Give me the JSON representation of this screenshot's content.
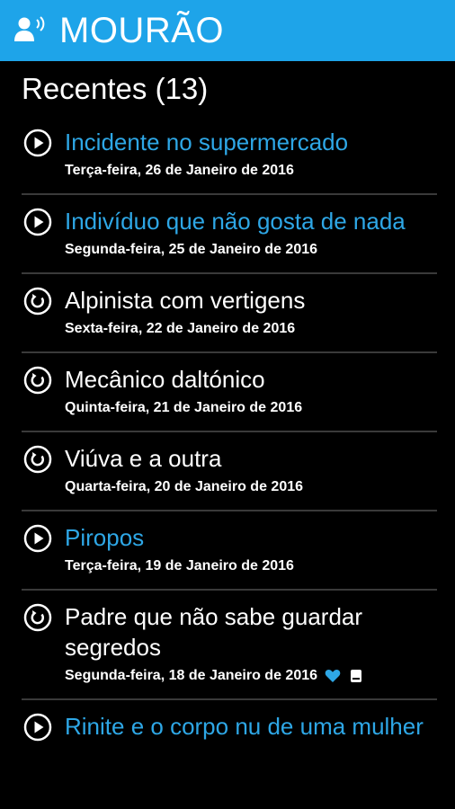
{
  "app": {
    "title": "MOURÃO",
    "brand_color": "#1ea4e9",
    "icon": "speaking-person-icon"
  },
  "section": {
    "title": "Recentes (13)"
  },
  "colors": {
    "new_title": "#2ea7e6",
    "played_title": "#ffffff",
    "divider": "#3a3a3a",
    "background": "#000000"
  },
  "episodes": [
    {
      "title": "Incidente no supermercado",
      "date": "Terça-feira, 26 de Janeiro de 2016",
      "status": "new",
      "icon": "play-circle-icon"
    },
    {
      "title": "Indivíduo que não gosta de nada",
      "date": "Segunda-feira, 25 de Janeiro de 2016",
      "status": "new",
      "icon": "play-circle-icon"
    },
    {
      "title": "Alpinista com vertigens",
      "date": "Sexta-feira, 22 de Janeiro de 2016",
      "status": "played",
      "icon": "replay-circle-icon"
    },
    {
      "title": "Mecânico daltónico",
      "date": "Quinta-feira, 21 de Janeiro de 2016",
      "status": "played",
      "icon": "replay-circle-icon"
    },
    {
      "title": "Viúva e a outra",
      "date": "Quarta-feira, 20 de Janeiro de 2016",
      "status": "played",
      "icon": "replay-circle-icon"
    },
    {
      "title": "Piropos",
      "date": "Terça-feira, 19 de Janeiro de 2016",
      "status": "new",
      "icon": "play-circle-icon"
    },
    {
      "title": "Padre que não sabe guardar segredos",
      "date": "Segunda-feira, 18 de Janeiro de 2016",
      "status": "played",
      "icon": "replay-circle-icon",
      "badges": [
        "heart-icon",
        "saved-icon"
      ]
    },
    {
      "title": "Rinite e o corpo nu de uma mulher",
      "date": "",
      "status": "new",
      "icon": "play-circle-icon"
    }
  ]
}
